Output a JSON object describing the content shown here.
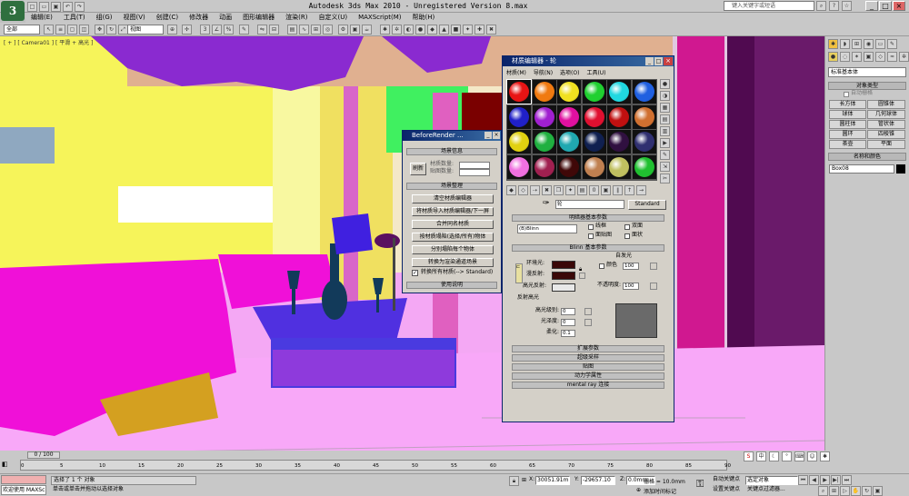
{
  "app": {
    "logo": "3ds Max",
    "title": "Autodesk 3ds Max  2010  - Unregistered Version  8.max",
    "search_placeholder": "键入关键字或短语"
  },
  "menu": [
    "编辑(E)",
    "工具(T)",
    "组(G)",
    "视图(V)",
    "创建(C)",
    "修改器",
    "动画",
    "图形编辑器",
    "渲染(R)",
    "自定义(U)",
    "MAXScript(M)",
    "帮助(H)"
  ],
  "toolbar": {
    "selection_filter": "全部",
    "ref_coord": "视图"
  },
  "viewport": {
    "label": "[ + ] [ Camera01 ] [ 平滑 + 高光 ]"
  },
  "cmd_panel": {
    "dropdown": "标准基本体",
    "rollout_object_type": "对象类型",
    "autogrid": "自动栅格",
    "buttons": [
      "长方体",
      "圆锥体",
      "球体",
      "几何球体",
      "圆柱体",
      "管状体",
      "圆环",
      "四棱锥",
      "茶壶",
      "平面"
    ],
    "rollout_name_color": "名称和颜色",
    "object_name": "Box08"
  },
  "before_render": {
    "title": "BeforeRender ...",
    "rollout_scene_info": "场景信息",
    "refresh": "刷新",
    "material_count_label": "材质数量:",
    "map_count_label": "贴图数量:",
    "rollout_scene_clean": "场景整理",
    "buttons": [
      "清空材质编辑器",
      "将材质导入材质编辑器/下一屏",
      "合并同名材质",
      "按材质塌陷(选择/所有)物体",
      "分别塌陷每个物体",
      "转换为渲染通道场景"
    ],
    "checkbox_convert": "转换所有材质(--> Standard)",
    "rollout_help": "使用说明"
  },
  "mat_editor": {
    "title": "材质编辑器 - 轮",
    "menu": [
      "材质(M)",
      "导航(N)",
      "选项(O)",
      "工具(U)"
    ],
    "material_name": "轮",
    "material_type": "Standard",
    "rollout_shader": "明暗器基本参数",
    "shader": "(B)Blinn",
    "shader_opts": [
      "线框",
      "双面",
      "面贴图",
      "面状"
    ],
    "rollout_blinn": "Blinn 基本参数",
    "self_illum": "自发光",
    "color_label": "颜色",
    "color_value": "100",
    "ambient": "环境光:",
    "diffuse": "漫反射:",
    "specular": "高光反射:",
    "opacity_label": "不透明度:",
    "opacity_value": "100",
    "spec_highlights": "反射高光",
    "spec_level": "高光级别:",
    "spec_level_value": "0",
    "glossiness": "光泽度:",
    "glossiness_value": "0",
    "soften": "柔化:",
    "soften_value": "0.1",
    "rollouts": [
      "扩展参数",
      "超级采样",
      "贴图",
      "动力学属性",
      "mental ray 连接"
    ],
    "sphere_colors": [
      "#e81414",
      "#f07a10",
      "#f0e020",
      "#20d030",
      "#20d8e0",
      "#2060e0",
      "#2020c8",
      "#a020d0",
      "#e010a0",
      "#e01030",
      "#c01010",
      "#d07030",
      "#e0d010",
      "#20b040",
      "#20a8b0",
      "#102050",
      "#301040",
      "#303070",
      "#f070e0",
      "#a02050",
      "#400808",
      "#c08050",
      "#c0c060",
      "#20c030"
    ],
    "colors": {
      "ambient": "#3a0808",
      "diffuse": "#3a0808",
      "specular": "#e8e8e8",
      "highlight_preview": "#6a6a6a"
    }
  },
  "timeline": {
    "frame": "0 / 100",
    "ticks": [
      "0",
      "5",
      "10",
      "15",
      "20",
      "25",
      "30",
      "35",
      "40",
      "45",
      "50",
      "55",
      "60",
      "65",
      "70",
      "75",
      "80",
      "85",
      "90"
    ]
  },
  "status": {
    "welcome": "欢迎使用 MAXSc",
    "selected": "选择了 1 个 对象",
    "prompt": "单击或单击并拖动以选择对象",
    "x_label": "X:",
    "x_value": "30051.91m",
    "y_label": "Y:",
    "y_value": "-29657.10",
    "z_label": "Z:",
    "z_value": "0.0mm",
    "grid": "栅格 = 10.0mm",
    "add_time_tag": "添加时间标记",
    "auto_key": "自动关键点",
    "set_key": "设置关键点",
    "selected_obj": "选定对象",
    "key_filters": "关键点过滤器..."
  }
}
